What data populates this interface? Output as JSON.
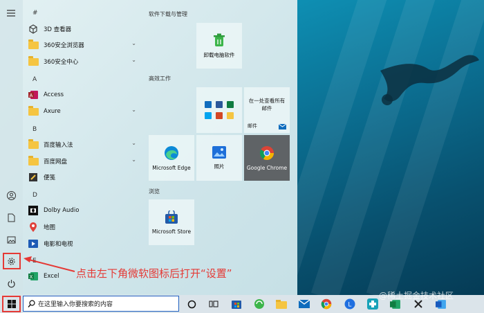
{
  "start_menu": {
    "apps": [
      {
        "letter": "#"
      },
      {
        "label": "3D 查看器",
        "icon": "cube-icon"
      },
      {
        "label": "360安全浏览器",
        "icon": "folder-icon",
        "expandable": true
      },
      {
        "label": "360安全中心",
        "icon": "folder-icon",
        "expandable": true
      },
      {
        "letter": "A"
      },
      {
        "label": "Access",
        "icon": "access-icon"
      },
      {
        "label": "Axure",
        "icon": "folder-icon",
        "expandable": true
      },
      {
        "letter": "B"
      },
      {
        "label": "百度输入法",
        "icon": "folder-icon",
        "expandable": true
      },
      {
        "label": "百度网盘",
        "icon": "folder-icon",
        "expandable": true
      },
      {
        "label": "便笺",
        "icon": "sticky-notes-icon"
      },
      {
        "letter": "D"
      },
      {
        "label": "Dolby Audio",
        "icon": "dolby-icon"
      },
      {
        "label": "地图",
        "icon": "map-pin-icon"
      },
      {
        "label": "电影和电视",
        "icon": "film-icon"
      },
      {
        "letter": "E"
      },
      {
        "label": "Excel",
        "icon": "excel-icon"
      }
    ],
    "sections": {
      "software": "软件下载与管理",
      "productivity": "高效工作",
      "browse": "浏览"
    },
    "tiles": {
      "uninstall": "卸载电脑软件",
      "mail_text": "在一处查看所有邮件",
      "mail_label": "邮件",
      "edge": "Microsoft Edge",
      "photos": "照片",
      "chrome": "Google Chrome",
      "store": "Microsoft Store"
    }
  },
  "taskbar": {
    "search_placeholder": "在这里输入你要搜索的内容"
  },
  "annotation": "点击左下角微软图标后打开“设置”",
  "watermark": "@稀土掘金技术社区",
  "colors": {
    "annotation_red": "#e53935",
    "search_border": "#1f5fbf"
  }
}
